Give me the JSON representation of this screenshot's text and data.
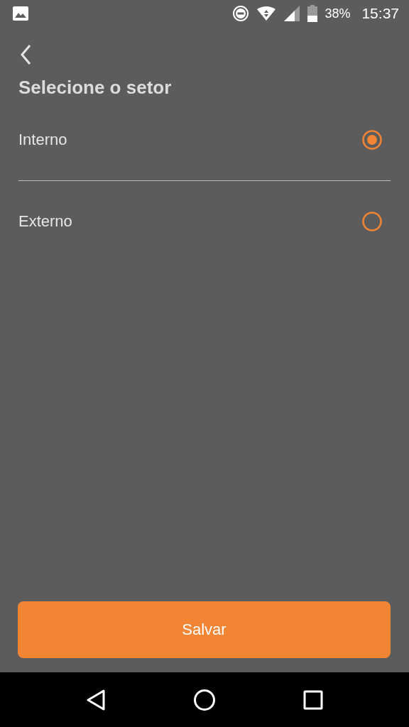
{
  "status_bar": {
    "battery": "38%",
    "time": "15:37"
  },
  "title": "Selecione o setor",
  "options": [
    {
      "label": "Interno",
      "selected": true
    },
    {
      "label": "Externo",
      "selected": false
    }
  ],
  "save_button": "Salvar"
}
